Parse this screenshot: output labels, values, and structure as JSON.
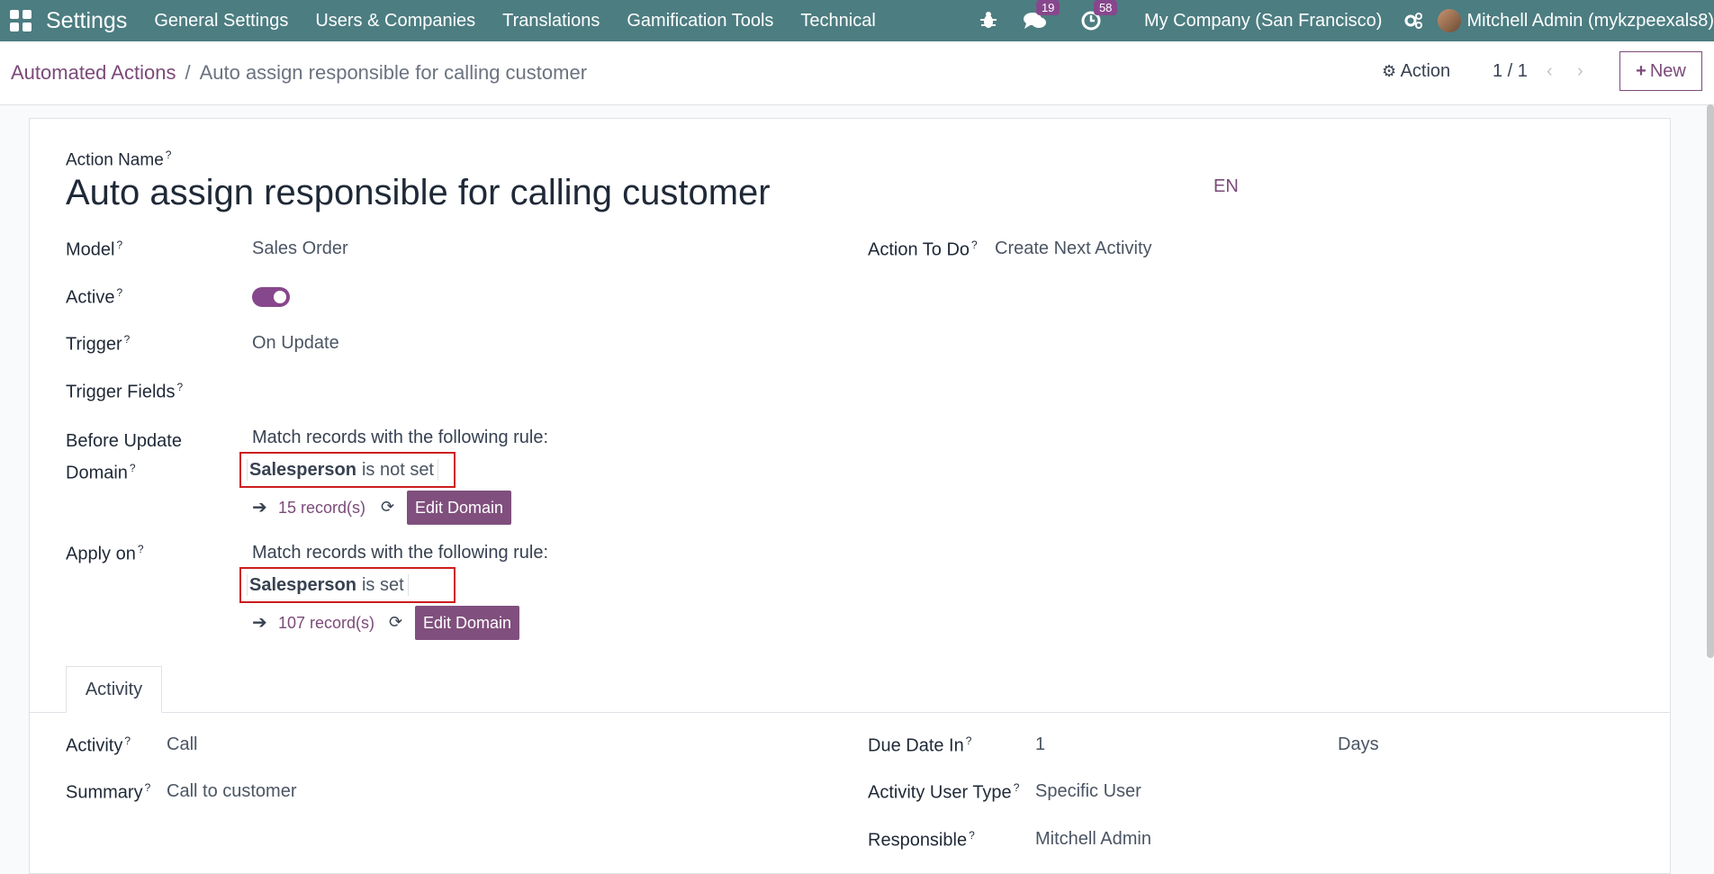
{
  "topbar": {
    "brand": "Settings",
    "menus": [
      "General Settings",
      "Users & Companies",
      "Translations",
      "Gamification Tools",
      "Technical"
    ],
    "messages_badge": "19",
    "activities_badge": "58",
    "company": "My Company (San Francisco)",
    "user": "Mitchell Admin (mykzpeexals8)"
  },
  "breadcrumb": {
    "parent": "Automated Actions",
    "separator": "/",
    "current": "Auto assign responsible for calling customer"
  },
  "control": {
    "action_label": "Action",
    "pager": "1 / 1",
    "new_label": "New"
  },
  "form": {
    "name_label": "Action Name",
    "name_value": "Auto assign responsible for calling customer",
    "lang": "EN",
    "model_label": "Model",
    "model_value": "Sales Order",
    "active_label": "Active",
    "trigger_label": "Trigger",
    "trigger_value": "On Update",
    "trigger_fields_label": "Trigger Fields",
    "before_domain_label_1": "Before Update",
    "before_domain_label_2": "Domain",
    "before_rule_text": "Match records with the following rule:",
    "before_field": "Salesperson",
    "before_op": "is not set",
    "before_count": "15 record(s)",
    "edit_domain": "Edit Domain",
    "apply_on_label": "Apply on",
    "apply_rule_text": "Match records with the following rule:",
    "apply_field": "Salesperson",
    "apply_op": "is set",
    "apply_count": "107 record(s)",
    "action_todo_label": "Action To Do",
    "action_todo_value": "Create Next Activity",
    "help_mark": "?"
  },
  "tabs": [
    "Activity"
  ],
  "activity": {
    "activity_label": "Activity",
    "activity_value": "Call",
    "summary_label": "Summary",
    "summary_value": "Call to customer",
    "due_label": "Due Date In",
    "due_value": "1",
    "due_unit": "Days",
    "user_type_label": "Activity User Type",
    "user_type_value": "Specific User",
    "responsible_label": "Responsible",
    "responsible_value": "Mitchell Admin"
  }
}
